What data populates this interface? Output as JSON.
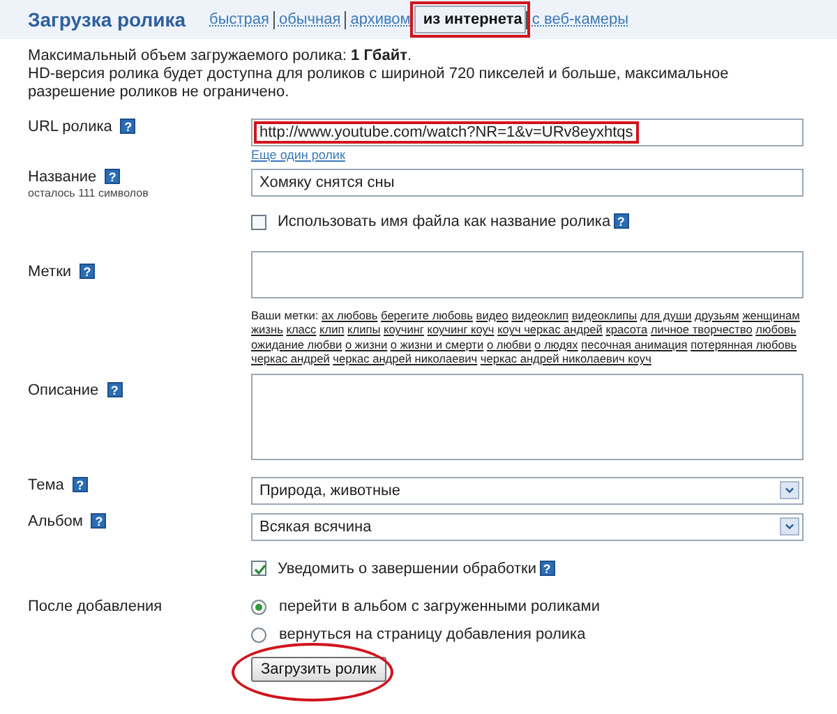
{
  "header": {
    "title": "Загрузка ролика",
    "tabs": [
      {
        "label": "быстрая",
        "selected": false,
        "highlighted": false
      },
      {
        "label": "обычная",
        "selected": false,
        "highlighted": false
      },
      {
        "label": "архивом",
        "selected": false,
        "highlighted": false
      },
      {
        "label": "из интернета",
        "selected": true,
        "highlighted": true
      },
      {
        "label": "с веб-камеры",
        "selected": false,
        "highlighted": false
      }
    ]
  },
  "info": [
    "Максимальный объем загружаемого ролика: **1 Гбайт**.",
    "HD-версия ролика будет доступна для роликов с шириной 720 пикселей и больше, максимальное разрешение роликов не ограничено."
  ],
  "url": {
    "label": "URL ролика",
    "help": "?",
    "value": "http://www.youtube.com/watch?NR=1&v=URv8eyxhtqs",
    "highlighted": true,
    "link": "Еще один ролик"
  },
  "name": {
    "label": "Название",
    "help": "?",
    "note": "осталось 111 символов",
    "value": "Хомяку снятся сны"
  },
  "use_filename": {
    "label": "Использовать имя файла как название ролика",
    "help": "?",
    "checked": false
  },
  "tags": {
    "label": "Метки",
    "help": "?",
    "your_tags_label": "Ваши метки:",
    "items": [
      "ах любовь",
      "берегите любовь",
      "видео",
      "видеоклип",
      "видеоклипы",
      "для души",
      "друзьям",
      "женщинам",
      "жизнь",
      "класс",
      "клип",
      "клипы",
      "коучинг",
      "коучинг коуч",
      "коуч черкас андрей",
      "красота",
      "личное творчество",
      "любовь",
      "ожидание любви",
      "о жизни",
      "о жизни и смерти",
      "о любви",
      "о людях",
      "песочная анимация",
      "потерянная любовь",
      "черкас андрей",
      "черкас андрей николаевич",
      "черкас андрей николаевич коуч"
    ]
  },
  "description": {
    "label": "Описание",
    "help": "?"
  },
  "theme": {
    "label": "Тема",
    "help": "?",
    "value": "Природа, животные"
  },
  "album": {
    "label": "Альбом",
    "help": "?",
    "value": "Всякая всячина"
  },
  "notify": {
    "label": "Уведомить о завершении обработки",
    "help": "?",
    "checked": true
  },
  "after_upload": {
    "label": "После добавления",
    "options": [
      {
        "label": "перейти в альбом с загруженными роликами",
        "selected": true
      },
      {
        "label": "вернуться на страницу добавления ролика",
        "selected": false
      }
    ]
  },
  "submit": {
    "label": "Загрузить ролик",
    "highlighted": true
  }
}
